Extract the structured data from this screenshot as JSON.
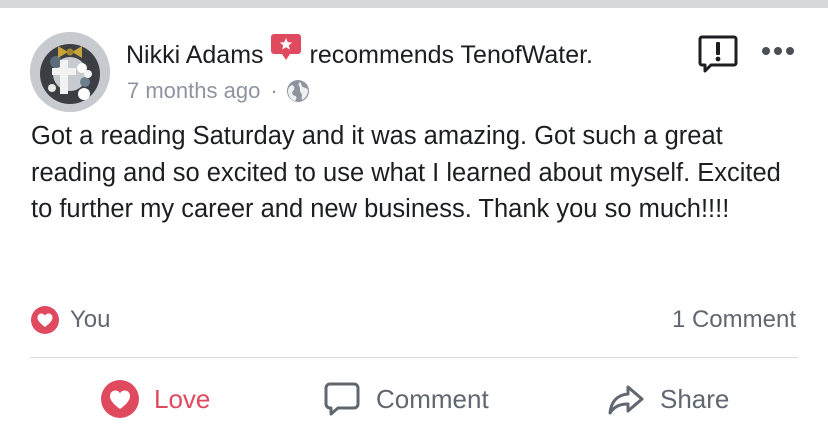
{
  "post": {
    "author": "Nikki Adams",
    "action_text": "recommends TenofWater.",
    "time": "7 months ago",
    "dot": "·",
    "body": "Got a reading Saturday and it was amazing. Got such a great reading and so excited to use what I learned about myself. Excited to further my career and new business. Thank you so much!!!!"
  },
  "reactions": {
    "summary": "You",
    "comments_count": "1 Comment"
  },
  "actions": {
    "love": "Love",
    "comment": "Comment",
    "share": "Share"
  },
  "colors": {
    "love_red": "#e04a5f",
    "text_primary": "#1c1e21",
    "text_secondary": "#606770",
    "meta_gray": "#8d949e",
    "divider": "#dadde1"
  },
  "icons": {
    "recommend": "recommend-badge-icon",
    "privacy": "globe-icon",
    "report": "report-icon",
    "more": "more-icon",
    "love_reaction": "heart-icon",
    "comment": "comment-icon",
    "share": "share-icon"
  }
}
